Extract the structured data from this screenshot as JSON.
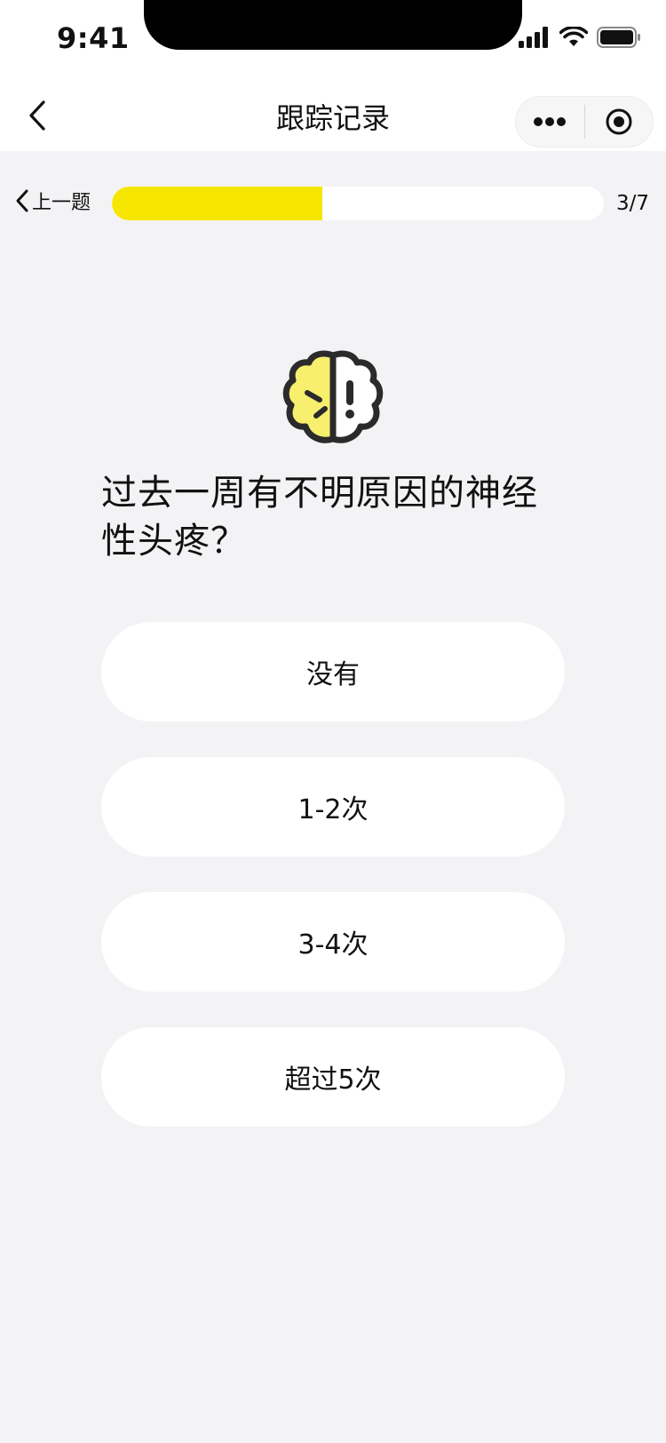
{
  "status_bar": {
    "time": "9:41"
  },
  "nav": {
    "title": "跟踪记录"
  },
  "quiz": {
    "prev_label": "上一题",
    "progress_current": 3,
    "progress_total": 7,
    "progress_fraction": 0.428,
    "progress_text": "3/7",
    "question": "过去一周有不明原因的神经性头疼？",
    "options": [
      {
        "label": "没有"
      },
      {
        "label": "1-2次"
      },
      {
        "label": "3-4次"
      },
      {
        "label": "超过5次"
      }
    ]
  },
  "colors": {
    "accent": "#f7e600",
    "background": "#f3f3f5",
    "card": "#ffffff",
    "brain_left": "#f9ef6e"
  },
  "icons": {
    "back": "chevron-left-icon",
    "more": "more-dots-icon",
    "target": "record-target-icon",
    "brain": "brain-alert-icon"
  }
}
